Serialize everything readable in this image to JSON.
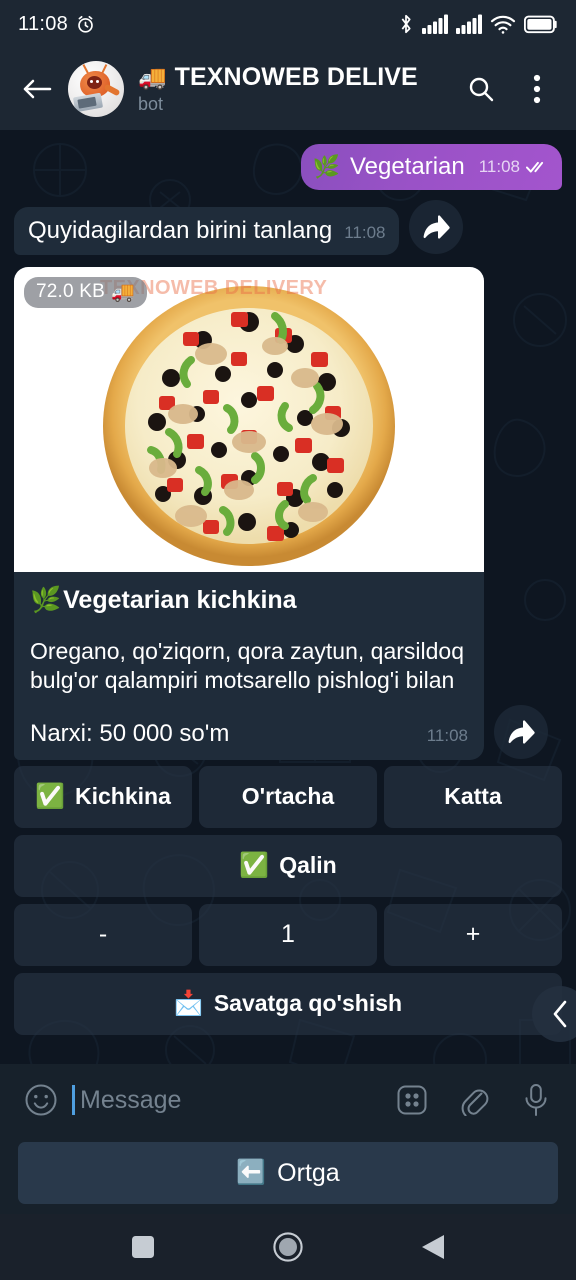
{
  "statusbar": {
    "time": "11:08",
    "icons": [
      "alarm-icon",
      "bluetooth-icon",
      "signal-icon",
      "signal-icon",
      "wifi-icon",
      "battery-icon"
    ]
  },
  "header": {
    "back_label": "back-arrow",
    "title_emoji": "🚚",
    "title": "TEXNOWEB DELIVE",
    "subtitle": "bot",
    "search_label": "search-icon",
    "menu_label": "more-options-icon"
  },
  "messages": {
    "outgoing": {
      "emoji": "🌿",
      "text": "Vegetarian",
      "time": "11:08",
      "status": "read"
    },
    "incoming_prompt": {
      "text": "Quyidagilardan birini tanlang",
      "time": "11:08"
    },
    "product_card": {
      "file_size": "72.0 KB",
      "file_emoji": "🚚",
      "watermark": "TEXNOWEB DELIVERY",
      "title_emoji": "🌿",
      "title": "Vegetarian kichkina",
      "description": "Oregano, qo'ziqorn, qora zaytun, qarsildoq bulg'or qalampiri motsarello pishlog'i bilan",
      "price": "Narxi: 50 000 so'm",
      "time": "11:08"
    }
  },
  "inline_keyboard": {
    "rows": [
      [
        {
          "emoji": "✅",
          "label": "Kichkina",
          "selected": true
        },
        {
          "emoji": "",
          "label": "O'rtacha",
          "selected": false
        },
        {
          "emoji": "",
          "label": "Katta",
          "selected": false
        }
      ],
      [
        {
          "emoji": "✅",
          "label": "Qalin",
          "selected": true
        }
      ],
      [
        {
          "emoji": "",
          "label": "-",
          "selected": false
        },
        {
          "emoji": "",
          "label": "1",
          "selected": false
        },
        {
          "emoji": "",
          "label": "+",
          "selected": false
        }
      ],
      [
        {
          "emoji": "📩",
          "label": "Savatga qo'shish",
          "selected": false
        }
      ]
    ]
  },
  "composer": {
    "emoji_button": "smiley-icon",
    "placeholder": "Message",
    "value": "",
    "attach_label": "paperclip-icon",
    "keyboard_label": "bot-commands-icon",
    "mic_label": "microphone-icon"
  },
  "reply_keyboard": {
    "back_emoji": "⬅️",
    "back_label": "Ortga"
  },
  "navbar": {
    "recents": "recents-square-icon",
    "home": "home-circle-icon",
    "back": "back-triangle-icon"
  },
  "colors": {
    "chat_bg": "#0e1621",
    "header_bg": "#1d2733",
    "bubble_in": "#1f2c3a",
    "bubble_out": "#9a52c7",
    "accent": "#4f9fe0",
    "reply_btn": "#29394b"
  }
}
